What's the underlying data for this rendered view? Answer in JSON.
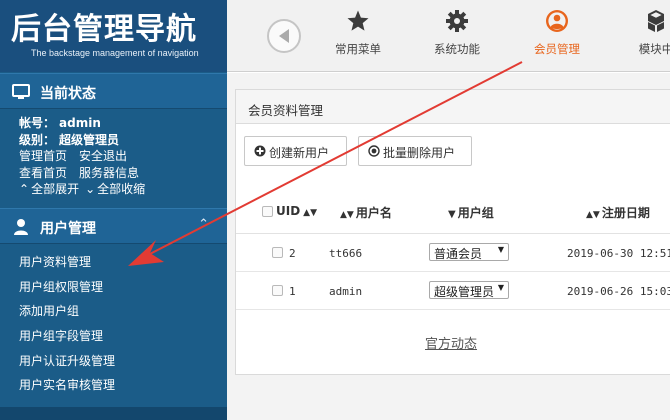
{
  "logo": {
    "title": "后台管理导航",
    "subtitle": "The backstage management of navigation"
  },
  "status_section": {
    "title": "当前状态",
    "account_label": "帐号：",
    "account_value": "admin",
    "level_label": "级别：",
    "level_value": "超级管理员",
    "links": [
      "管理首页",
      "安全退出",
      "查看首页",
      "服务器信息"
    ],
    "expand_all": "全部展开",
    "collapse_all": "全部收缩"
  },
  "user_section": {
    "title": "用户管理",
    "items": [
      "用户资料管理",
      "用户组权限管理",
      "添加用户组",
      "用户组字段管理",
      "用户认证升级管理",
      "用户实名审核管理"
    ]
  },
  "topnav": {
    "items": [
      {
        "label": "常用菜单",
        "icon": "star-icon"
      },
      {
        "label": "系统功能",
        "icon": "gear-icon"
      },
      {
        "label": "会员管理",
        "icon": "user-circle-icon",
        "active": true
      },
      {
        "label": "模块中",
        "icon": "cubes-icon"
      }
    ],
    "active_color": "#e8651d"
  },
  "panel": {
    "title": "会员资料管理",
    "create_button": "创建新用户",
    "batch_delete_button": "批量删除用户"
  },
  "table": {
    "headers": [
      "UID",
      "用户名",
      "用户组",
      "注册日期"
    ],
    "rows": [
      {
        "uid": "2",
        "username": "tt666",
        "group": "普通会员",
        "date": "2019-06-30 12:51"
      },
      {
        "uid": "1",
        "username": "admin",
        "group": "超级管理员",
        "date": "2019-06-26 15:03"
      }
    ]
  },
  "official_link": "官方动态",
  "colors": {
    "sidebar": "#1b5c88",
    "annotation_arrow": "#e23b33"
  }
}
